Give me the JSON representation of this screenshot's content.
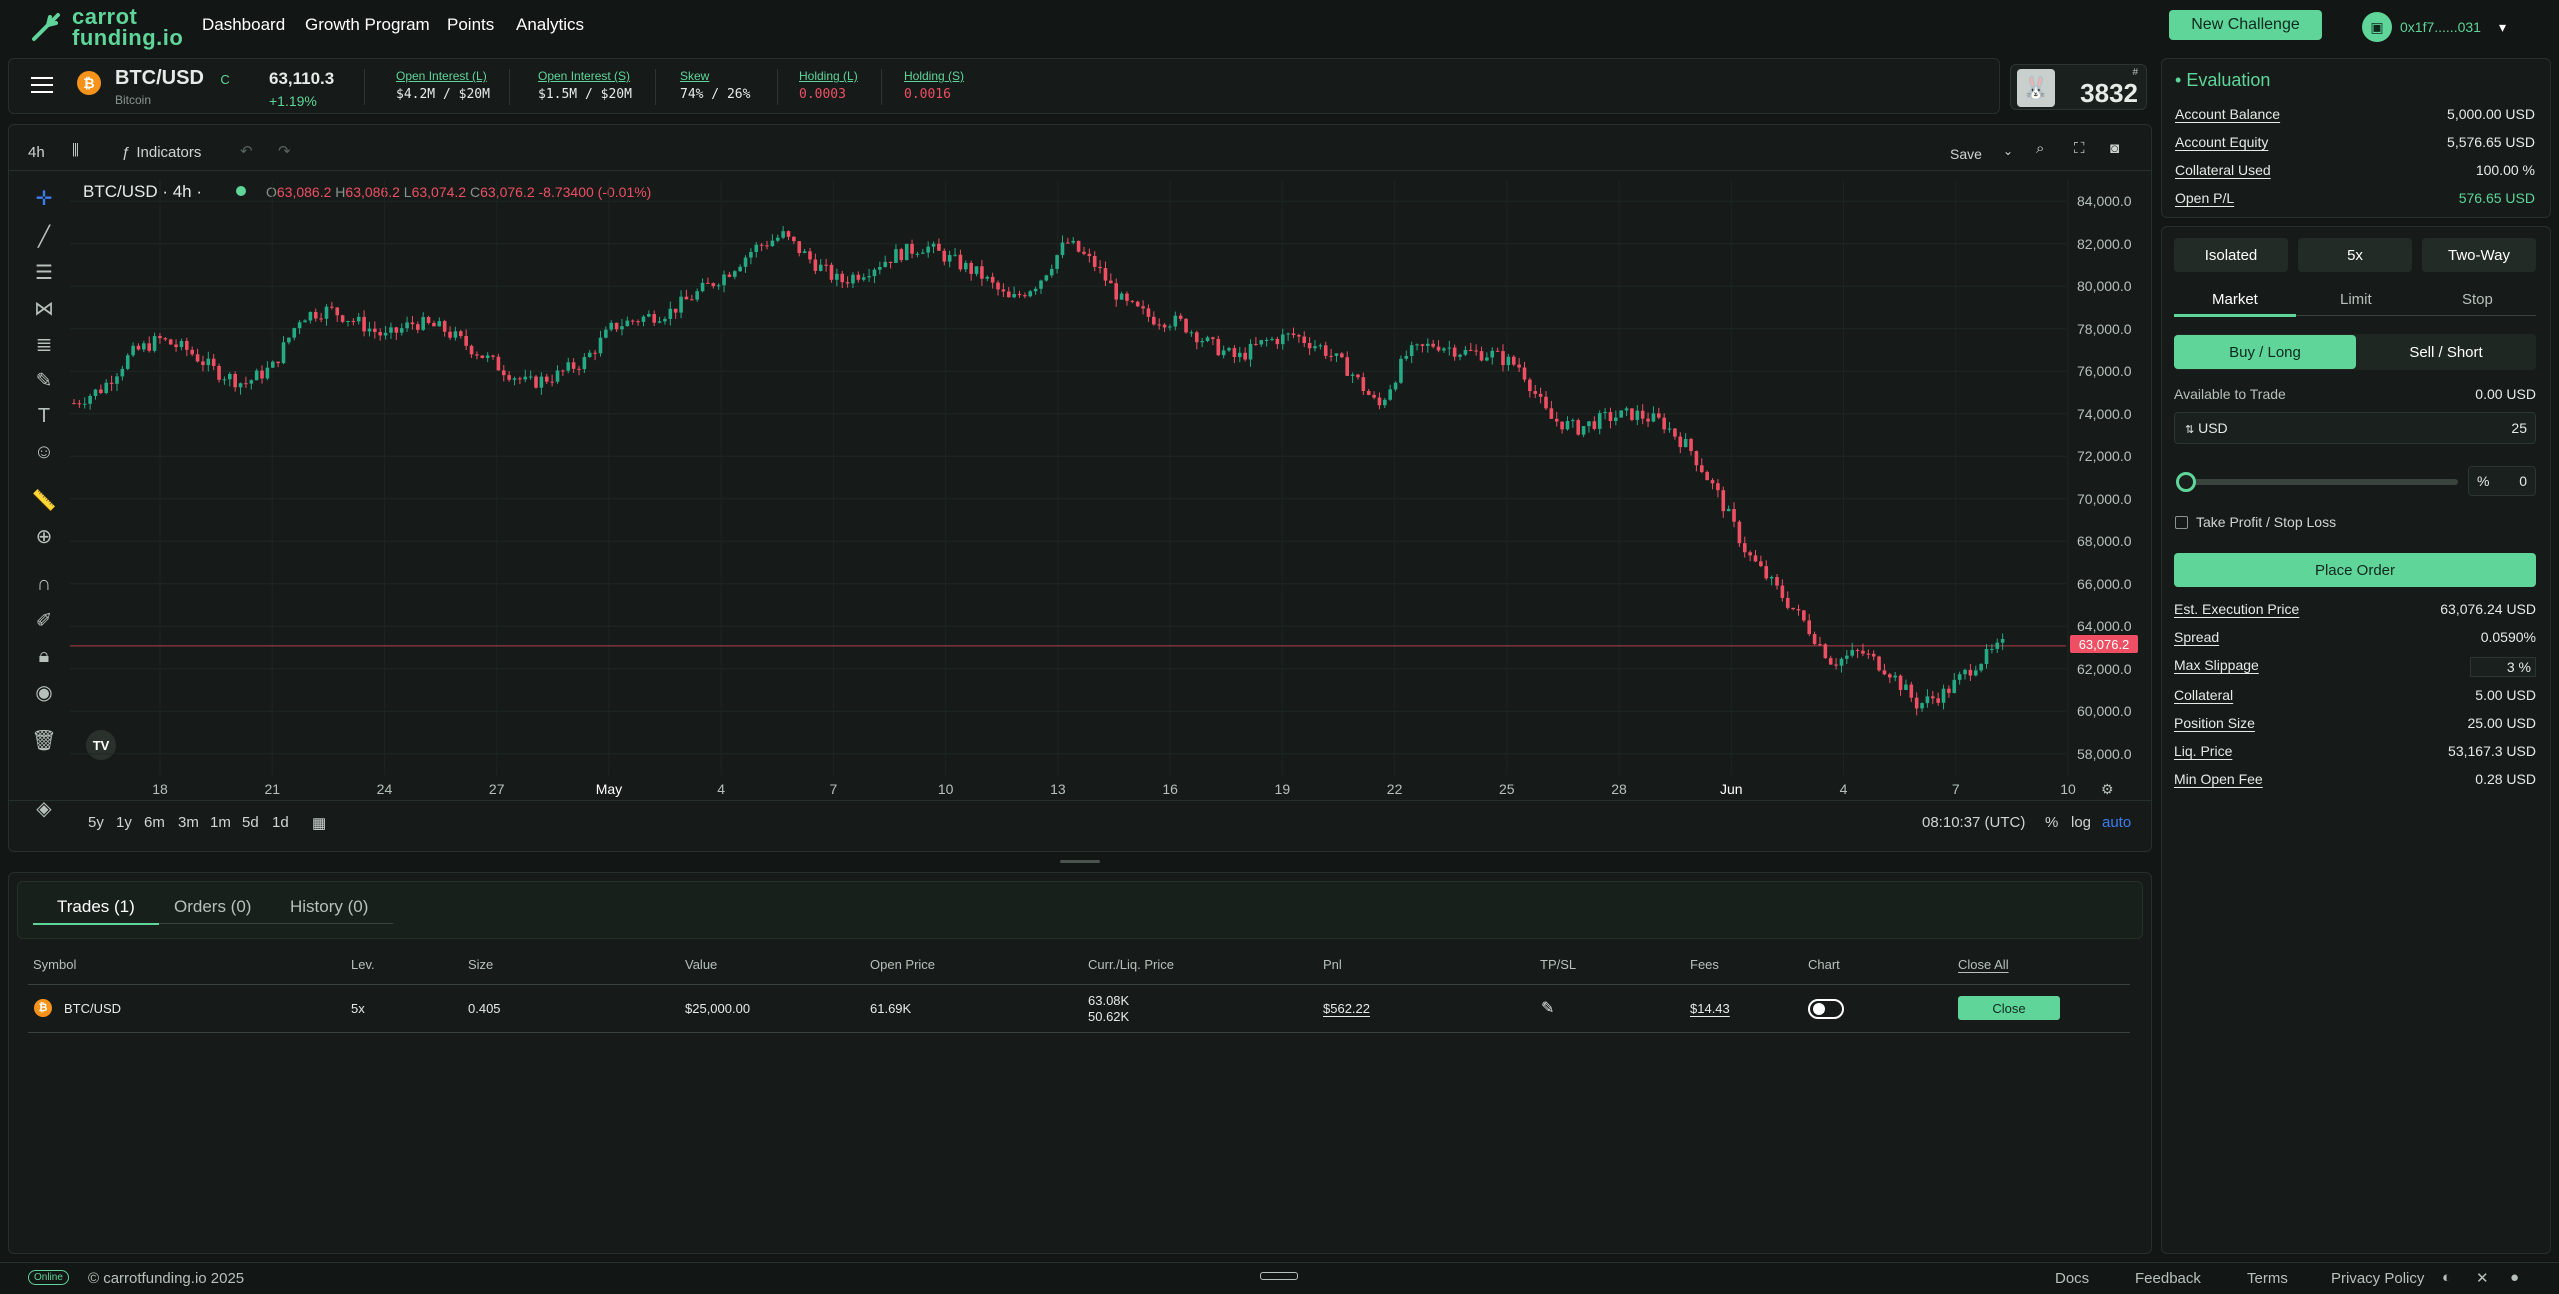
{
  "nav": {
    "logo_line1": "carrot",
    "logo_line2": "funding.io",
    "links": [
      "Dashboard",
      "Growth Program",
      "Points",
      "Analytics"
    ],
    "new_challenge": "New Challenge",
    "wallet": "0x1f7......031"
  },
  "ticker": {
    "symbol": "BTC/USD",
    "badge": "C",
    "name": "Bitcoin",
    "price": "63,110.3",
    "change": "+1.19%",
    "stats": [
      {
        "label": "Open Interest (L)",
        "value": "$4.2M / $20M"
      },
      {
        "label": "Open Interest (S)",
        "value": "$1.5M / $20M"
      },
      {
        "label": "Skew",
        "value": "74% / 26%"
      },
      {
        "label": "Holding (L)",
        "value": "0.0003"
      },
      {
        "label": "Holding (S)",
        "value": "0.0016"
      }
    ],
    "rank": "3832",
    "rank_hash": "#"
  },
  "chart_toolbar": {
    "interval": "4h",
    "indicators": "Indicators",
    "save": "Save"
  },
  "chart_legend": {
    "title": "BTC/USD · 4h ·",
    "o_label": "O",
    "o": "63,086.2",
    "h_label": "H",
    "h": "63,086.2",
    "l_label": "L",
    "l": "63,074.2",
    "c_label": "C",
    "c": "63,076.2",
    "chg": "-8.73400 (-0.01%)"
  },
  "chart_data": {
    "type": "candlestick",
    "ylim": [
      57000,
      85000
    ],
    "y_ticks": [
      "84,000.0",
      "82,000.0",
      "80,000.0",
      "78,000.0",
      "76,000.0",
      "74,000.0",
      "72,000.0",
      "70,000.0",
      "68,000.0",
      "66,000.0",
      "64,000.0",
      "62,000.0",
      "60,000.0",
      "58,000.0"
    ],
    "x_ticks": [
      "18",
      "21",
      "24",
      "27",
      "May",
      "4",
      "7",
      "10",
      "13",
      "16",
      "19",
      "22",
      "25",
      "28",
      "Jun",
      "4",
      "7",
      "10"
    ],
    "last_price": "63,076.2",
    "close_path": [
      74500,
      75200,
      76800,
      77500,
      77000,
      76000,
      75400,
      76200,
      78600,
      78900,
      78300,
      77600,
      78300,
      78000,
      77100,
      76200,
      75400,
      75800,
      76500,
      78100,
      78500,
      78800,
      79700,
      80600,
      81800,
      82400,
      81200,
      80200,
      80800,
      81500,
      81900,
      81200,
      80500,
      79300,
      80200,
      82100,
      81000,
      79200,
      78500,
      78300,
      77300,
      76600,
      77400,
      77700,
      77100,
      76000,
      74300,
      76800,
      77300,
      76900,
      76800,
      76200,
      73800,
      73300,
      73800,
      74000,
      73600,
      72300,
      70100,
      67400,
      65800,
      64200,
      62300,
      62800,
      61900,
      60300,
      60900,
      62200,
      63100
    ]
  },
  "range_buttons": [
    "5y",
    "1y",
    "6m",
    "3m",
    "1m",
    "5d",
    "1d"
  ],
  "chart_footer": {
    "time": "08:10:37 (UTC)",
    "pct": "%",
    "log": "log",
    "auto": "auto"
  },
  "trades": {
    "tabs": [
      "Trades (1)",
      "Orders (0)",
      "History (0)"
    ],
    "headers": [
      "Symbol",
      "Lev.",
      "Size",
      "Value",
      "Open Price",
      "Curr./Liq. Price",
      "Pnl",
      "TP/SL",
      "Fees",
      "Chart",
      "Close All"
    ],
    "row": {
      "symbol": "BTC/USD",
      "lev": "5x",
      "size": "0.405",
      "value": "$25,000.00",
      "open": "61.69K",
      "curr": "63.08K",
      "liq": "50.62K",
      "pnl": "$562.22",
      "fees": "$14.43",
      "close": "Close"
    }
  },
  "evaluation": {
    "title": "Evaluation",
    "rows": [
      {
        "label": "Account Balance",
        "value": "5,000.00 USD"
      },
      {
        "label": "Account Equity",
        "value": "5,576.65 USD"
      },
      {
        "label": "Collateral Used",
        "value": "100.00 %"
      },
      {
        "label": "Open P/L",
        "value": "576.65 USD"
      }
    ]
  },
  "order": {
    "margin_mode": "Isolated",
    "leverage": "5x",
    "position_mode": "Two-Way",
    "types": [
      "Market",
      "Limit",
      "Stop"
    ],
    "buy": "Buy / Long",
    "sell": "Sell / Short",
    "available_label": "Available to Trade",
    "available_value": "0.00 USD",
    "currency": "USD",
    "amount": "25",
    "pct_symbol": "%",
    "pct_value": "0",
    "slider_fraction": 0,
    "tpsl": "Take Profit / Stop Loss",
    "place": "Place Order",
    "details": [
      {
        "label": "Est. Execution Price",
        "value": "63,076.24 USD"
      },
      {
        "label": "Spread",
        "value": "0.0590%"
      },
      {
        "label": "Max Slippage",
        "value": "3 %"
      },
      {
        "label": "Collateral",
        "value": "5.00 USD"
      },
      {
        "label": "Position Size",
        "value": "25.00 USD"
      },
      {
        "label": "Liq. Price",
        "value": "53,167.3 USD"
      },
      {
        "label": "Min Open Fee",
        "value": "0.28 USD"
      }
    ]
  },
  "footer": {
    "status": "Online",
    "copyright": "© carrotfunding.io 2025",
    "links": [
      "Docs",
      "Feedback",
      "Terms",
      "Privacy Policy"
    ]
  }
}
